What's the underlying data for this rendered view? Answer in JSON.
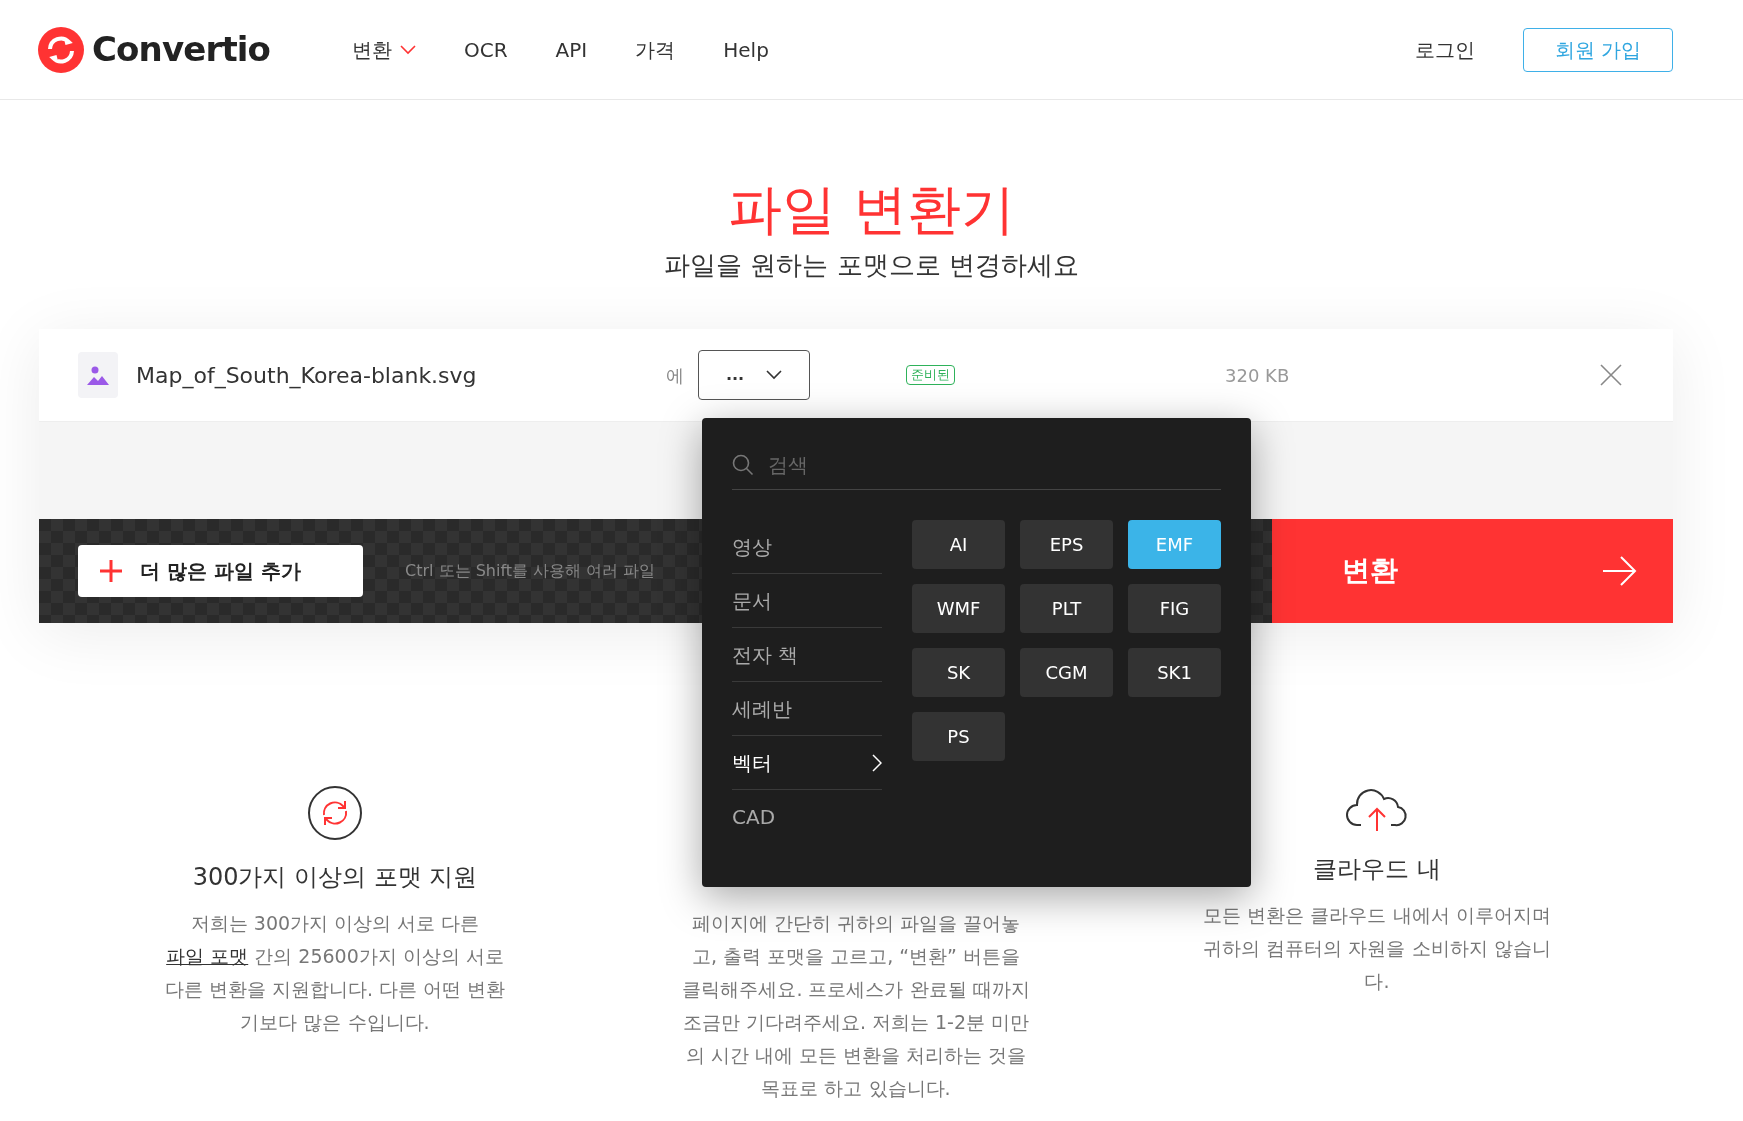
{
  "header": {
    "logo": "Convertio",
    "nav": [
      {
        "label": "변환",
        "has_caret": true
      },
      {
        "label": "OCR",
        "has_caret": false
      },
      {
        "label": "API",
        "has_caret": false
      },
      {
        "label": "가격",
        "has_caret": false
      },
      {
        "label": "Help",
        "has_caret": false
      }
    ],
    "login": "로그인",
    "signup": "회원 가입"
  },
  "hero": {
    "title": "파일 변환기",
    "subtitle": "파일을 원하는 포맷으로 변경하세요"
  },
  "file": {
    "name": "Map_of_South_Korea-blank.svg",
    "to_label": "에",
    "format": "...",
    "status": "준비된",
    "size": "320 KB"
  },
  "toolbar": {
    "add_button": "더 많은 파일 추가",
    "hint": "Ctrl 또는 Shift를 사용해 여러 파일",
    "convert_button": "변환"
  },
  "dropdown": {
    "search_placeholder": "검색",
    "categories": [
      {
        "label": "영상",
        "selected": false
      },
      {
        "label": "문서",
        "selected": false
      },
      {
        "label": "전자 책",
        "selected": false
      },
      {
        "label": "세례반",
        "selected": false
      },
      {
        "label": "벡터",
        "selected": true
      },
      {
        "label": "CAD",
        "selected": false
      }
    ],
    "formats": [
      {
        "label": "AI",
        "selected": false
      },
      {
        "label": "EPS",
        "selected": false
      },
      {
        "label": "EMF",
        "selected": true
      },
      {
        "label": "WMF",
        "selected": false
      },
      {
        "label": "PLT",
        "selected": false
      },
      {
        "label": "FIG",
        "selected": false
      },
      {
        "label": "SK",
        "selected": false
      },
      {
        "label": "CGM",
        "selected": false
      },
      {
        "label": "SK1",
        "selected": false
      },
      {
        "label": "PS",
        "selected": false
      }
    ]
  },
  "features": [
    {
      "kind": "formats",
      "title": "300가지 이상의 포맷 지원",
      "before": "저희는 300가지 이상의 서로 다른 ",
      "link": "파일 포맷",
      "after": " 간의 25600가지 이상의 서로 다른 변환을 지원합니다. 다른 어떤 변환기보다 많은 수입니다."
    },
    {
      "kind": "fast",
      "before": "페이지에 간단히 귀하의 파일을 끌어놓고, 출력 포맷을 고르고, “변환” 버튼을 클릭해주세요. 프로세스가 완료될 때까지 조금만 기다려주세요. 저희는 1-2분 미만의 시간 내에 모든 변환을 처리하는 것을 목표로 하고 있습니다."
    },
    {
      "kind": "cloud",
      "title": "클라우드 내",
      "before": "모든 변환은 클라우드 내에서 이루어지며 귀하의 컴퓨터의 자원을 소비하지 않습니다."
    }
  ]
}
